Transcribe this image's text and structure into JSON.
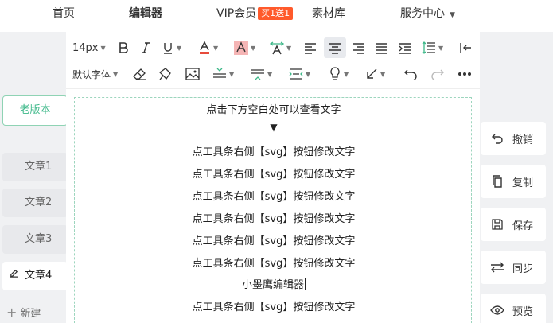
{
  "nav": {
    "home": "首页",
    "editor": "编辑器",
    "vip": "VIP会员",
    "vip_badge": "买1送1",
    "materials": "素材库",
    "service": "服务中心"
  },
  "sidebar": {
    "old_version": "老版本",
    "articles": [
      "文章1",
      "文章2",
      "文章3",
      "文章4"
    ],
    "new": "新建"
  },
  "toolbar": {
    "font_size": "14px",
    "font_family": "默认字体"
  },
  "content": {
    "hint": "点击下方空白处可以查看文字",
    "arrow": "▼",
    "line": "点工具条右侧【svg】按钮修改文字",
    "brand": "小墨鹰编辑器"
  },
  "actions": {
    "undo": "撤销",
    "copy": "复制",
    "save": "保存",
    "sync": "同步",
    "preview": "预览"
  },
  "colors": {
    "accent": "#3db889",
    "badge": "#ff5a2b",
    "font_color_bar": "#e74c3c",
    "bg_color_bar": "#f5b5b5"
  }
}
